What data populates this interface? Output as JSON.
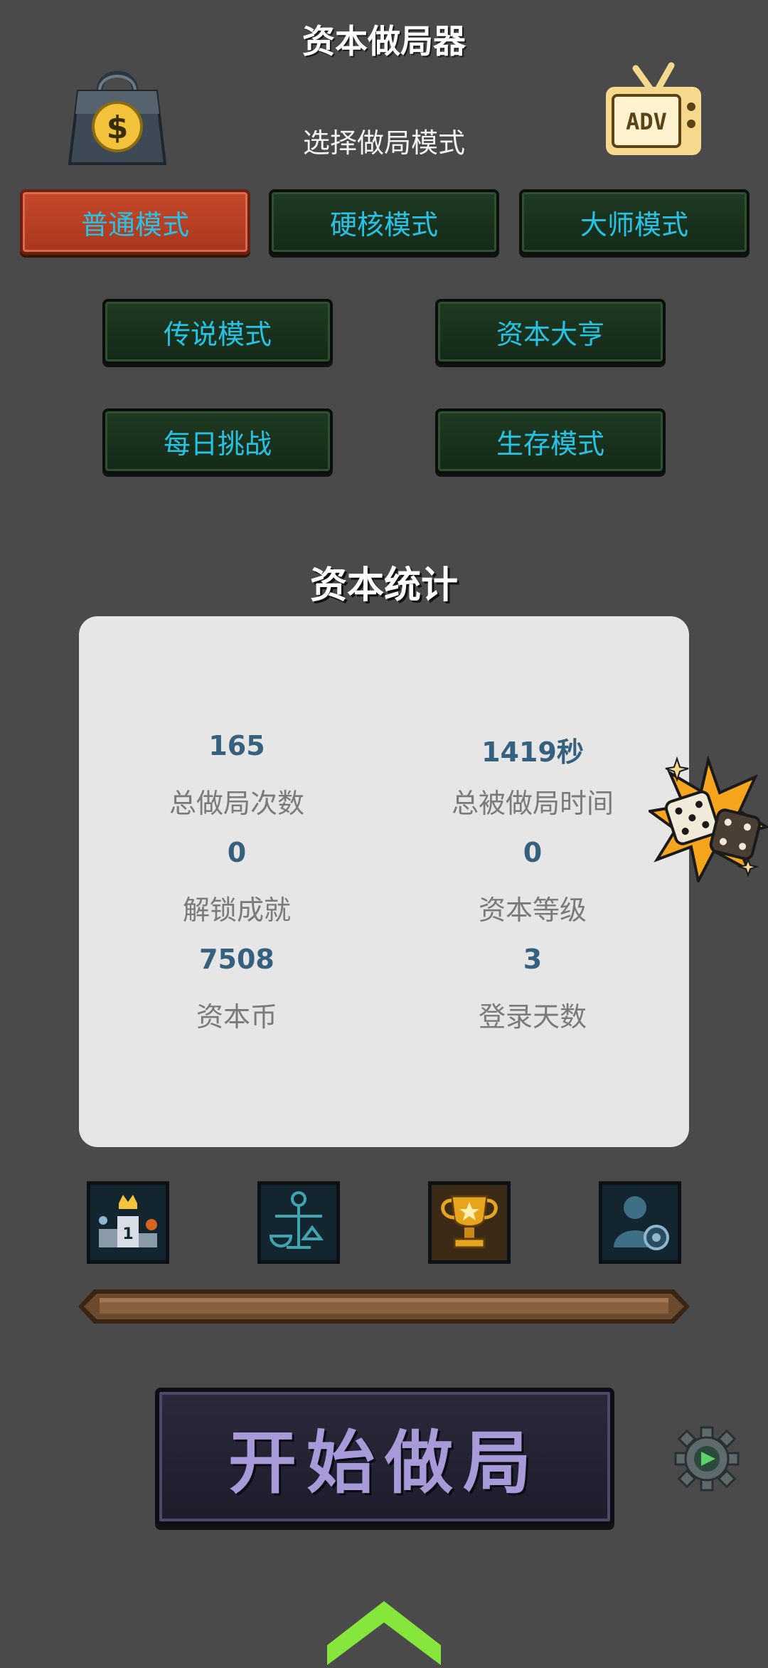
{
  "header": {
    "title": "资本做局器",
    "subtitle": "选择做局模式"
  },
  "modes": [
    {
      "label": "普通模式",
      "active": true
    },
    {
      "label": "硬核模式",
      "active": false
    },
    {
      "label": "大师模式",
      "active": false
    },
    {
      "label": "传说模式",
      "active": false
    },
    {
      "label": "资本大亨",
      "active": false
    },
    {
      "label": "每日挑战",
      "active": false
    },
    {
      "label": "生存模式",
      "active": false
    }
  ],
  "stats": {
    "title": "资本统计",
    "items": [
      {
        "value": "165",
        "label": "总做局次数"
      },
      {
        "value": "1419秒",
        "label": "总被做局时间"
      },
      {
        "value": "0",
        "label": "解锁成就"
      },
      {
        "value": "0",
        "label": "资本等级"
      },
      {
        "value": "7508",
        "label": "资本币"
      },
      {
        "value": "3",
        "label": "登录天数"
      }
    ]
  },
  "toolbar_icons": [
    "leaderboard-icon",
    "balance-scale-icon",
    "trophy-icon",
    "profile-settings-icon"
  ],
  "top_icons": {
    "shop": "dollar-bag-icon",
    "adv": "tv-adv-icon",
    "adv_text": "ADV"
  },
  "start_button": {
    "label": "开始做局"
  },
  "colors": {
    "background": "#4a4a4a",
    "mode_text": "#27c3e6",
    "active_mode": "#c7492a",
    "stat_value": "#35617f",
    "start_text": "#a89ad8",
    "arrow": "#86e63c"
  }
}
